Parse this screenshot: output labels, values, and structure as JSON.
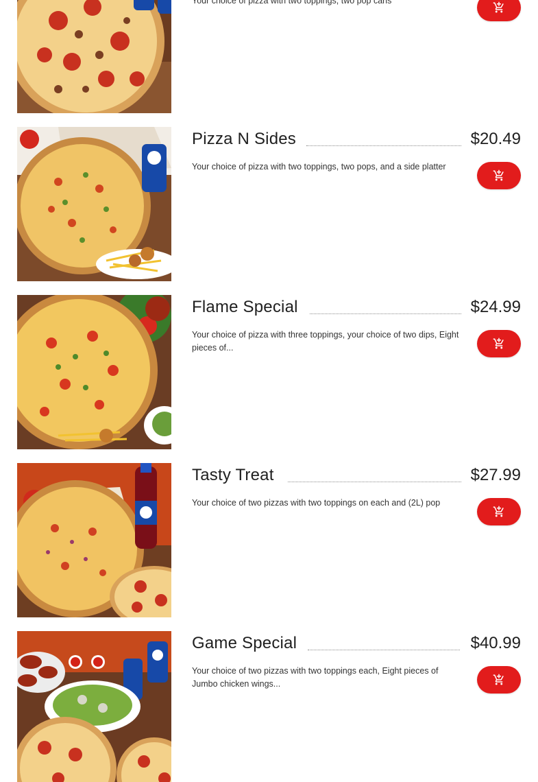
{
  "accent_color": "#e21c1c",
  "items": [
    {
      "name": "",
      "price": "",
      "description": "Your choice of pizza with two toppings, two pop cans",
      "image": "pizza-with-pepsi-cans",
      "button_icon": "add-to-cart-icon"
    },
    {
      "name": "Pizza N Sides",
      "price": "$20.49",
      "description": "Your choice of pizza with two toppings, two pops, and a side platter",
      "image": "pizza-with-pepsi-and-fries",
      "button_icon": "add-to-cart-icon"
    },
    {
      "name": "Flame Special",
      "price": "$24.99",
      "description": "Your choice of pizza with three toppings, your choice of two dips, Eight pieces of...",
      "image": "pizza-with-wings-and-salad",
      "button_icon": "add-to-cart-icon"
    },
    {
      "name": "Tasty Treat",
      "price": "$27.99",
      "description": "Your choice of two pizzas with two toppings on each and (2L) pop",
      "image": "two-pizzas-with-pepsi-bottle",
      "button_icon": "add-to-cart-icon"
    },
    {
      "name": "Game Special",
      "price": "$40.99",
      "description": "Your choice of two pizzas with two toppings each, Eight pieces of Jumbo chicken wings...",
      "image": "pizzas-wings-salad-pepsi",
      "button_icon": "add-to-cart-icon"
    }
  ]
}
